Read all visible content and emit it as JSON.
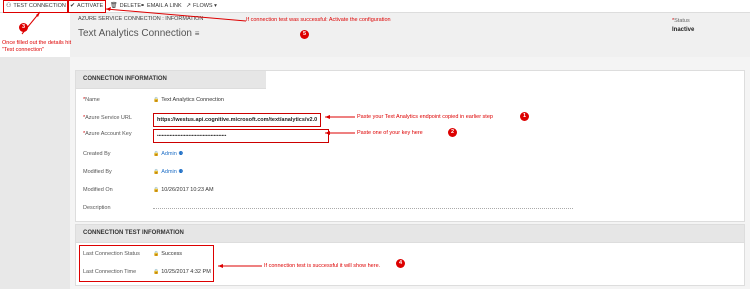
{
  "toolbar": {
    "test_connection": "TEST CONNECTION",
    "activate": "ACTIVATE",
    "delete": "DELETE",
    "email_link": "EMAIL A LINK",
    "flows": "FLOWS"
  },
  "header": {
    "entity_type": "AZURE SERVICE CONNECTION : INFORMATION",
    "title": "Text Analytics Connection",
    "status_label": "Status",
    "status_value": "Inactive"
  },
  "connection_info": {
    "heading": "CONNECTION INFORMATION",
    "name_label": "Name",
    "name_value": "Text Analytics Connection",
    "url_label": "Azure Service URL",
    "url_value": "https://westus.api.cognitive.microsoft.com/text/analytics/v2.0",
    "key_label": "Azure Account Key",
    "key_value": "••••••••••••••••••••••••••••••••••••••••••••",
    "created_by_label": "Created By",
    "created_by_value": "Admin",
    "modified_by_label": "Modified By",
    "modified_by_value": "Admin",
    "modified_on_label": "Modified On",
    "modified_on_value": "10/26/2017  10:23 AM",
    "description_label": "Description"
  },
  "connection_test": {
    "heading": "CONNECTION TEST INFORMATION",
    "status_label": "Last Connection Status",
    "status_value": "Success",
    "time_label": "Last Connection Time",
    "time_value": "10/25/2017  4:32 PM"
  },
  "annotations": {
    "n1": "1",
    "n2": "2",
    "n3": "3",
    "n4": "4",
    "n5": "5",
    "note1": "Paste your Text Analytics endpoint copied in earlier step",
    "note2": "Paste one of your key here",
    "note3": "Once filled out the details hit \"Test connection\"",
    "note4": "If connection test is successful it will show here.",
    "note5": "If connection test was successful: Activate the configuration"
  },
  "colors": {
    "annotation": "#dd0000",
    "link": "#1f6fc6",
    "required": "#cc0000"
  }
}
